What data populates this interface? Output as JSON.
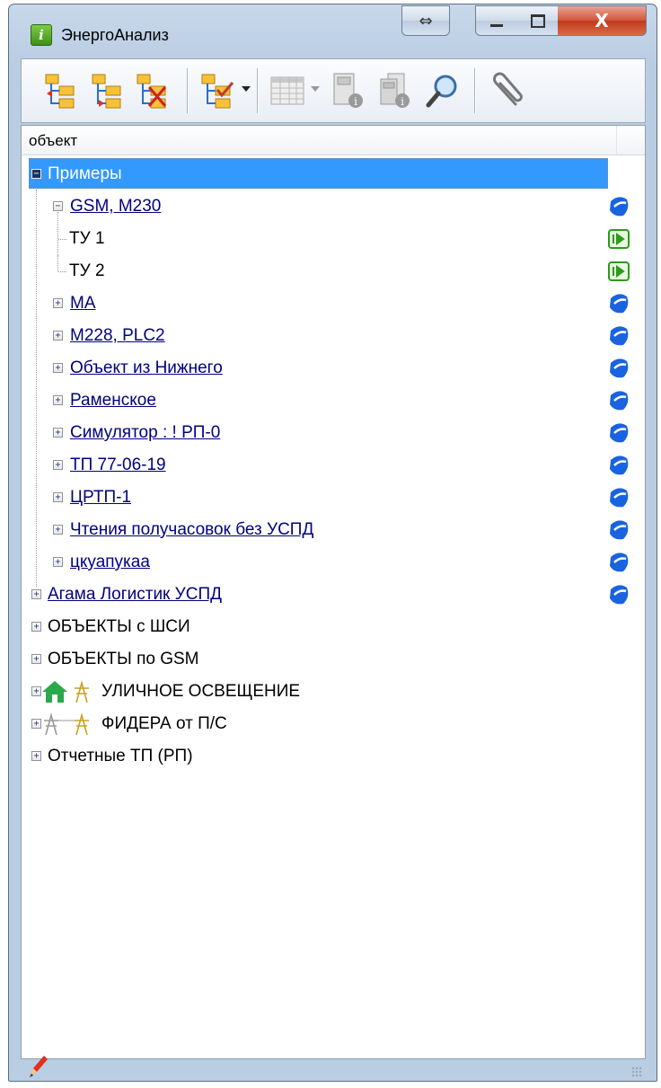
{
  "window": {
    "title": "ЭнергоАнализ",
    "app_icon_letter": "i",
    "resize_glyph": "⇔",
    "min_glyph": "▁",
    "max_glyph": "▢",
    "close_glyph": "X"
  },
  "toolbar": {
    "buttons": [
      {
        "icon": "tree-add-icon"
      },
      {
        "icon": "tree-remove-icon"
      },
      {
        "icon": "tree-delete-icon"
      },
      {
        "icon": "tree-check-icon",
        "dropdown": true
      },
      {
        "icon": "table-icon",
        "dropdown": true,
        "disabled": true
      },
      {
        "icon": "device-info-icon",
        "disabled": true
      },
      {
        "icon": "devices-info-icon",
        "disabled": true
      },
      {
        "icon": "magnifier-icon"
      },
      {
        "icon": "paperclip-icon"
      }
    ]
  },
  "column": {
    "header": "объект"
  },
  "tree": {
    "root": {
      "label": "Примеры",
      "expanded": true,
      "selected": true
    },
    "gsm": {
      "label": "GSM, M230",
      "expanded": true
    },
    "tu1": {
      "label": "ТУ 1"
    },
    "tu2": {
      "label": "ТУ 2"
    },
    "children": [
      {
        "label": "MA"
      },
      {
        "label": "M228, PLC2"
      },
      {
        "label": "Объект из Нижнего"
      },
      {
        "label": "Раменское"
      },
      {
        "label": "Симулятор : ! РП-0"
      },
      {
        "label": "ТП 77-06-19"
      },
      {
        "label": "ЦРТП-1"
      },
      {
        "label": "Чтения получасовок без УСПД"
      },
      {
        "label": "цкуапукаа"
      }
    ],
    "top_level": [
      {
        "label": "Агама Логистик УСПД"
      },
      {
        "label": "ОБЪЕКТЫ с ШСИ"
      },
      {
        "label": "ОБЪЕКТЫ по GSM"
      },
      {
        "label": "УЛИЧНОЕ ОСВЕЩЕНИЕ"
      },
      {
        "label": "ФИДЕРА от П/С"
      },
      {
        "label": "Отчетные ТП (РП)"
      }
    ]
  },
  "colors": {
    "selection": "#3399ff",
    "link": "#000080",
    "status_blue": "#1a63e0",
    "status_green": "#2d9a1c"
  }
}
